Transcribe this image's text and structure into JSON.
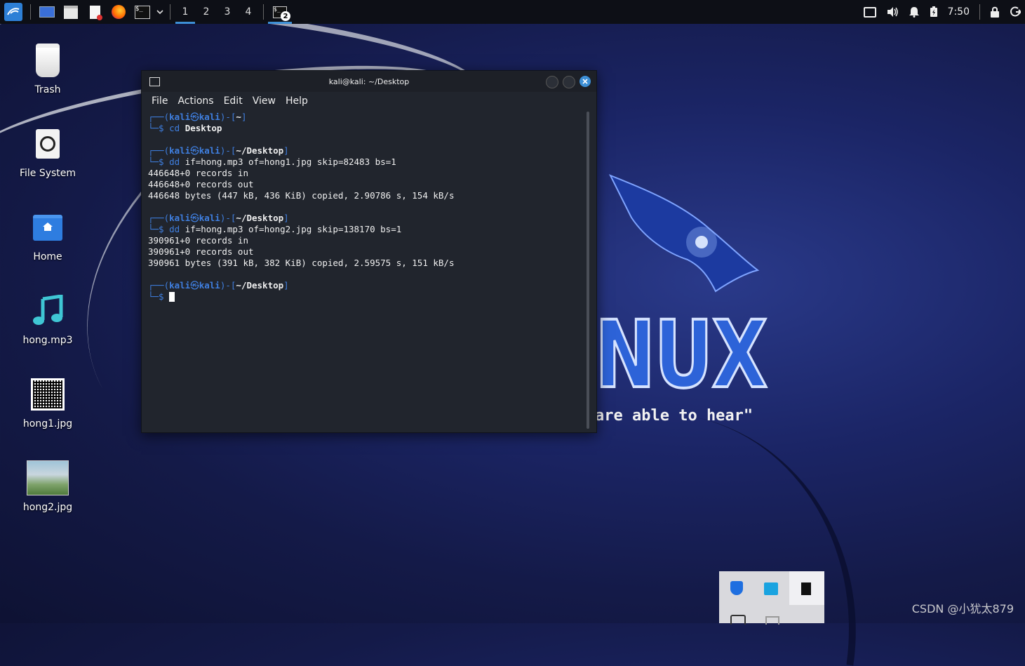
{
  "panel": {
    "workspaces": [
      "1",
      "2",
      "3",
      "4"
    ],
    "active_workspace": "1",
    "task_badge": "2",
    "clock": "7:50",
    "icons": [
      "kali-menu-icon",
      "desktop-icon",
      "files-icon",
      "text-editor-icon",
      "firefox-icon",
      "terminal-icon",
      "dropdown-icon",
      "screen-icon",
      "volume-icon",
      "bell-icon",
      "battery-icon",
      "lock-icon",
      "logout-icon"
    ]
  },
  "desktop": {
    "icons": [
      {
        "label": "Trash"
      },
      {
        "label": "File System"
      },
      {
        "label": "Home"
      },
      {
        "label": "hong.mp3"
      },
      {
        "label": "hong1.jpg"
      },
      {
        "label": "hong2.jpg"
      }
    ]
  },
  "wallpaper": {
    "big_text": "NUX",
    "slogan": "are able to hear\""
  },
  "terminal": {
    "title": "kali@kali: ~/Desktop",
    "menu": [
      "File",
      "Actions",
      "Edit",
      "View",
      "Help"
    ],
    "prompt_user": "kali",
    "prompt_at": "㉿",
    "prompt_host": "kali",
    "blocks": [
      {
        "dir": "~",
        "cmd": "cd",
        "arg": "Desktop",
        "output": []
      },
      {
        "dir": "~/Desktop",
        "cmd": "dd",
        "arg": "if=hong.mp3 of=hong1.jpg skip=82483 bs=1",
        "output": [
          "446648+0 records in",
          "446648+0 records out",
          "446648 bytes (447 kB, 436 KiB) copied, 2.90786 s, 154 kB/s"
        ]
      },
      {
        "dir": "~/Desktop",
        "cmd": "dd",
        "arg": "if=hong.mp3 of=hong2.jpg skip=138170 bs=1",
        "output": [
          "390961+0 records in",
          "390961+0 records out",
          "390961 bytes (391 kB, 382 KiB) copied, 2.59575 s, 151 kB/s"
        ]
      },
      {
        "dir": "~/Desktop",
        "cmd": "",
        "arg": "",
        "output": []
      }
    ]
  },
  "watermark": "CSDN @小犹太879"
}
